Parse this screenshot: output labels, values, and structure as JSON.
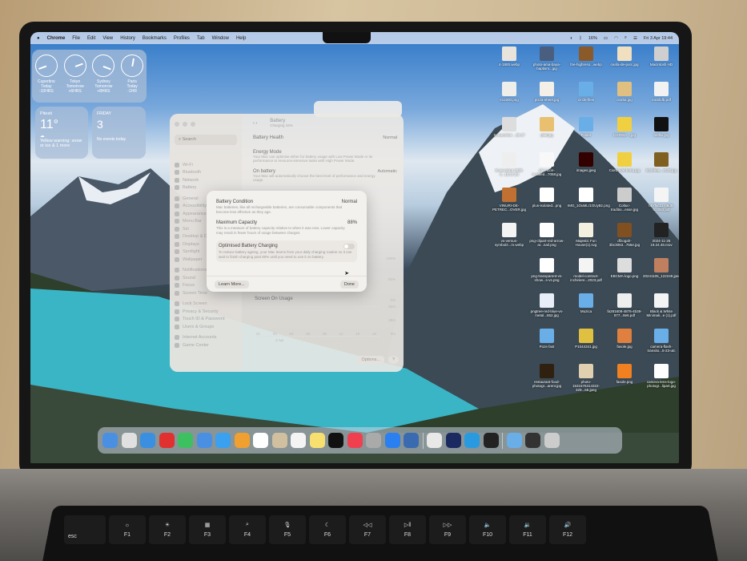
{
  "menubar": {
    "app": "Chrome",
    "items": [
      "File",
      "Edit",
      "View",
      "History",
      "Bookmarks",
      "Profiles",
      "Tab",
      "Window",
      "Help"
    ],
    "battery": "16%",
    "datetime": "Fri 3 Apr 19:44"
  },
  "widgets": {
    "clocks": [
      {
        "city": "Cupertino",
        "day": "Today",
        "offset": "-10HRS"
      },
      {
        "city": "Tokyo",
        "day": "Tomorrow",
        "offset": "+6HRS"
      },
      {
        "city": "Sydney",
        "day": "Tomorrow",
        "offset": "+8HRS"
      },
      {
        "city": "Paris",
        "day": "Today",
        "offset": "-1HR"
      }
    ],
    "weather": {
      "location": "Pitesti",
      "temp": "11°",
      "alert": "Yellow warning: snow or ice & 1 more"
    },
    "calendar": {
      "weekday": "FRIDAY",
      "day": "3",
      "events": "No events today"
    }
  },
  "settings": {
    "search_placeholder": "Search",
    "title": "Battery",
    "subtitle": "Charging 16%",
    "sidebar": [
      "Wi-Fi",
      "Bluetooth",
      "Network",
      "Battery",
      "General",
      "Accessibility",
      "Appearance",
      "Menu Bar",
      "Siri",
      "Desktop & Dock",
      "Displays",
      "Spotlight",
      "Wallpaper",
      "Notifications",
      "Sound",
      "Focus",
      "Screen Time",
      "Lock Screen",
      "Privacy & Security",
      "Touch ID & Password",
      "Users & Groups",
      "Internet Accounts",
      "Game Center"
    ],
    "battery_health_label": "Battery Health",
    "battery_health_value": "Normal",
    "energy_mode_label": "Energy Mode",
    "energy_mode_desc": "Your Mac can optimise either for battery usage with Low Power Mode or its performance to resource-intensive tasks with High Power Mode.",
    "on_battery_label": "On battery",
    "on_battery_desc": "Your Mac will automatically choose the best level of performance and energy usage.",
    "on_battery_value": "Automatic",
    "screen_usage_label": "Screen On Usage",
    "chart_ticks": [
      "21",
      "00",
      "03",
      "06",
      "09",
      "12",
      "15",
      "18"
    ],
    "chart_date": "3 Apr",
    "chart_y": [
      "100%",
      "50%",
      "0%",
      "60m",
      "30m",
      "0m"
    ],
    "options_button": "Options...",
    "help_button": "?"
  },
  "dialog": {
    "condition_label": "Battery Condition",
    "condition_value": "Normal",
    "condition_desc": "Mac batteries, like all rechargeable batteries, are consumable components that become less effective as they age.",
    "capacity_label": "Maximum Capacity",
    "capacity_value": "88%",
    "capacity_desc": "This is a measure of battery capacity relative to when it was new. Lower capacity may result in fewer hours of usage between charges.",
    "optimised_label": "Optimised Battery Charging",
    "optimised_desc": "To reduce battery ageing, your Mac learns from your daily charging routine so it can wait to finish charging past 80% until you need to use it on battery.",
    "optimised_on": false,
    "learn_more": "Learn More...",
    "done": "Done"
  },
  "desktop_icons": [
    {
      "label": "4-1800.webp",
      "color": "#e8e4dc"
    },
    {
      "label": "photo-ama-baya-baptism...jpg",
      "color": "#4a5f80"
    },
    {
      "label": "frie-highreso...webp",
      "color": "#8a5a2a"
    },
    {
      "label": "ceafa-de-porc.jpg",
      "color": "#f0e0c0"
    },
    {
      "label": "Macintosh HD",
      "color": "#cfcfcf"
    },
    {
      "label": "e11600.png",
      "color": "#eeeeea"
    },
    {
      "label": "pizza-sheet.jpg",
      "color": "#f4f0e8"
    },
    {
      "label": "circle-files",
      "color": "#6aaee8"
    },
    {
      "label": "ciorba.jpg",
      "color": "#e0c080"
    },
    {
      "label": "e43d1fb.pdf",
      "color": "#f2f2f2"
    },
    {
      "label": "Screenshot ...20.27",
      "color": "#ddd"
    },
    {
      "label": "pilaf.jpg",
      "color": "#e8c070"
    },
    {
      "label": "Folder",
      "color": "#6aaee8"
    },
    {
      "label": "CIORBA ...jpg",
      "color": "#f0d040"
    },
    {
      "label": "netflix.jpg",
      "color": "#111"
    },
    {
      "label": "Screenshot 2025-0...18.24.23",
      "color": "#eee"
    },
    {
      "label": "plus-icon-isolated...7058.jpg",
      "color": "#f8f8f8"
    },
    {
      "label": "images.jpeg",
      "color": "#300"
    },
    {
      "label": "Ciorba-de-burta.jpg",
      "color": "#f0d040"
    },
    {
      "label": "52166ae...2125.jpg",
      "color": "#806020"
    },
    {
      "label": "VINURI-DE-PETREC...OVER.jpg",
      "color": "#c07030"
    },
    {
      "label": "plus-isolated...png",
      "color": "#fff"
    },
    {
      "label": "IMG_1OuMLr1OUyBz.png",
      "color": "#fff"
    },
    {
      "label": "Coltuc-traditio...esse.jpg",
      "color": "#ccc"
    },
    {
      "label": "087f6c21-08d6-4...083.pdf",
      "color": "#f4f4f4"
    },
    {
      "label": "vs-versus-symbol2...m.webp",
      "color": "#f4f4f4"
    },
    {
      "label": "png-clipart-red-arrow-ar...nail.png",
      "color": "#fff"
    },
    {
      "label": "Majestic Fun House(1).svg",
      "color": "#f4f0e0"
    },
    {
      "label": "dfzogah-3bc3063...755e.jpg",
      "color": "#805020"
    },
    {
      "label": "2024-11-26 19.24.46.mov",
      "color": "#222"
    },
    {
      "label": "png-transparent-vs-show...s-vs.png",
      "color": "#fff"
    },
    {
      "label": "model-contract-inchiriere...2023.pdf",
      "color": "#f4f4f4"
    },
    {
      "label": "EBCMA-logo.png",
      "color": "#ddd"
    },
    {
      "label": "20241105_122249.jpeg",
      "color": "#c08060"
    },
    {
      "label": "pngtree-red-blue-vs-metal...652.jpg",
      "color": "#e8eef8"
    },
    {
      "label": "Muzica",
      "color": "#6aaee8"
    },
    {
      "label": "fa281608-4876-4b38-877...8e6.pdf",
      "color": "#eee"
    },
    {
      "label": "Black & White Minimali...e (1).pdf",
      "color": "#f4f4f4"
    },
    {
      "label": "Poze fast",
      "color": "#6aaee8"
    },
    {
      "label": "P1044341.jpg",
      "color": "#e0c040"
    },
    {
      "label": "fasole.jpg",
      "color": "#e08040"
    },
    {
      "label": "camera-flash-transito...5-23-utc",
      "color": "#6aaee8"
    },
    {
      "label": "restaurant-food-photogr...arent.jpg",
      "color": "#302010"
    },
    {
      "label": "photo-1531576314322-329...65.jpeg",
      "color": "#e0d0b0"
    },
    {
      "label": "fasole.png",
      "color": "#f08020"
    },
    {
      "label": "camera-lens-logo-photogr...lipart.jpg",
      "color": "#fff"
    }
  ],
  "dock": [
    "#4a90e2",
    "#e0e0e0",
    "#3a8fe0",
    "#e03030",
    "#3cc060",
    "#4a90e2",
    "#3aa0f0",
    "#f0a030",
    "#fff",
    "#d0c0a0",
    "#f4f4f4",
    "#f8e070",
    "#111",
    "#f04050",
    "#aaa",
    "#2a80f0",
    "#3a6ab0",
    "sep",
    "#e8e8e8",
    "#1a2a60",
    "#2a9ae0",
    "#222",
    "sep",
    "#6aaee8",
    "#333",
    "#ccc"
  ],
  "keyboard": [
    {
      "label": "esc",
      "glyph": ""
    },
    {
      "label": "F1",
      "glyph": "☼"
    },
    {
      "label": "F2",
      "glyph": "☀"
    },
    {
      "label": "F3",
      "glyph": "▦"
    },
    {
      "label": "F4",
      "glyph": "⌕"
    },
    {
      "label": "F5",
      "glyph": "🎙"
    },
    {
      "label": "F6",
      "glyph": "☾"
    },
    {
      "label": "F7",
      "glyph": "◁◁"
    },
    {
      "label": "F8",
      "glyph": "▷‖"
    },
    {
      "label": "F9",
      "glyph": "▷▷"
    },
    {
      "label": "F10",
      "glyph": "🔈"
    },
    {
      "label": "F11",
      "glyph": "🔉"
    },
    {
      "label": "F12",
      "glyph": "🔊"
    }
  ]
}
